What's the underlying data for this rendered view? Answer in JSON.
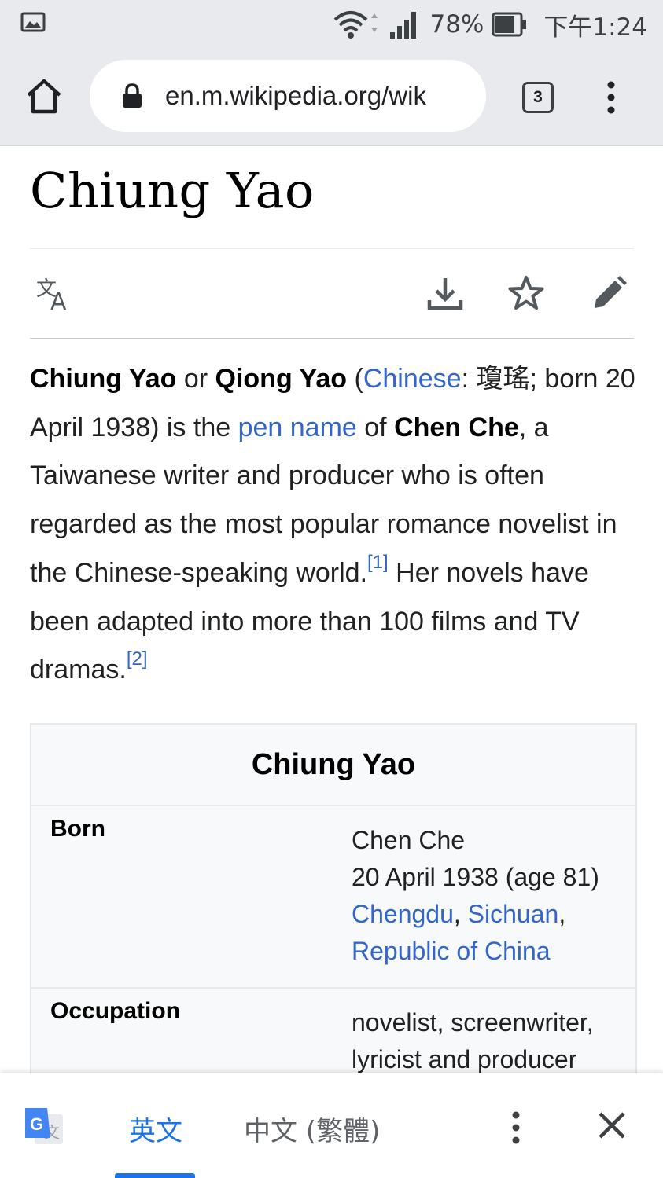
{
  "status_bar": {
    "battery_percent": "78%",
    "time": "下午1:24",
    "icons": [
      "gallery-icon",
      "wifi-icon",
      "signal-icon",
      "battery-icon"
    ]
  },
  "browser": {
    "url": "en.m.wikipedia.org/wik",
    "tab_count": "3",
    "icons": [
      "home-icon",
      "lock-icon",
      "menu-dots-icon"
    ]
  },
  "article": {
    "title": "Chiung Yao",
    "action_icons": [
      "language-icon",
      "download-icon",
      "star-icon",
      "edit-icon"
    ],
    "lead": {
      "t1": "Chiung Yao",
      "t2": " or ",
      "t3": "Qiong Yao",
      "t4": " (",
      "link_chinese": "Chinese",
      "t5": ": 瓊瑤; born 20 April 1938) is the ",
      "link_pen_name": "pen name",
      "t6": " of ",
      "t7": "Chen Che",
      "t8": ", a Taiwanese writer and producer who is often regarded as the most popular romance novelist in the Chinese-speaking world.",
      "ref1": "[1]",
      "t9": " Her novels have been adapted into more than 100 films and TV dramas.",
      "ref2": "[2]"
    }
  },
  "infobox": {
    "title": "Chiung Yao",
    "born_label": "Born",
    "born_name": "Chen Che",
    "born_date": "20 April 1938 (age 81)",
    "born_city": "Chengdu",
    "born_sep": ", ",
    "born_province": "Sichuan",
    "born_comma": ",",
    "born_country": "Republic of China",
    "occupation_label": "Occupation",
    "occupation_value": "novelist, screenwriter, lyricist and producer"
  },
  "translate_bar": {
    "lang_source": "英文",
    "lang_target": "中文 (繁體)",
    "icons": [
      "google-translate-icon",
      "more-options-icon",
      "close-icon"
    ],
    "colors": {
      "active": "#1a73e8",
      "inactive": "#5f6368"
    }
  },
  "colors": {
    "link": "#3366cc",
    "chrome_bg": "#e8eaed"
  }
}
